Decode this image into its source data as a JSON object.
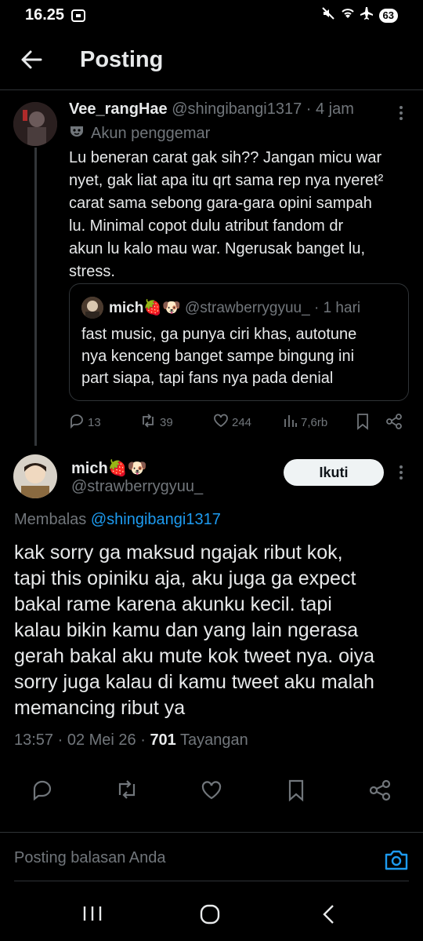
{
  "status": {
    "time": "16.25",
    "battery": "63"
  },
  "header": {
    "title": "Posting"
  },
  "parent": {
    "display_name": "Vee_rangHae",
    "handle": "@shingibangi1317",
    "time": "· 4 jam",
    "label": "Akun penggemar",
    "text_lines": [
      "Lu beneran carat gak sih?? Jangan micu war",
      "nyet, gak liat apa itu qrt sama rep nya nyeret²",
      "carat sama sebong gara-gara opini sampah",
      "lu. Minimal copot dulu atribut fandom dr",
      "akun lu kalo mau war. Ngerusak banget lu,",
      "stress."
    ],
    "quote": {
      "display_name": "mich🍓🐶",
      "handle": "@strawberrygyuu_",
      "time": "· 1 hari",
      "text_lines": [
        "fast music, ga punya ciri khas, autotune",
        "nya kenceng banget sampe bingung ini",
        "part siapa, tapi fans nya pada denial"
      ]
    },
    "actions": {
      "replies": "13",
      "reposts": "39",
      "likes": "244",
      "views": "7,6rb"
    }
  },
  "main": {
    "display_name": "mich🍓🐶",
    "handle": "@strawberrygyuu_",
    "follow_label": "Ikuti",
    "replying_prefix": "Membalas",
    "replying_to": "@shingibangi1317",
    "text_lines": [
      "kak sorry ga maksud ngajak ribut kok,",
      "tapi this opiniku aja, aku juga ga expect",
      "bakal rame karena akunku kecil. tapi",
      "kalau bikin kamu dan yang lain ngerasa",
      "gerah bakal aku mute kok tweet nya. oiya",
      "sorry juga kalau di kamu tweet aku malah",
      "memancing ribut ya"
    ],
    "timestamp": "13:57 · 02 Mei 26 ·",
    "views_count": "701",
    "views_label": "Tayangan"
  },
  "reply": {
    "placeholder": "Posting balasan Anda"
  },
  "colors": {
    "link": "#1d9bf0",
    "muted": "#71767b",
    "bg": "#000000"
  }
}
